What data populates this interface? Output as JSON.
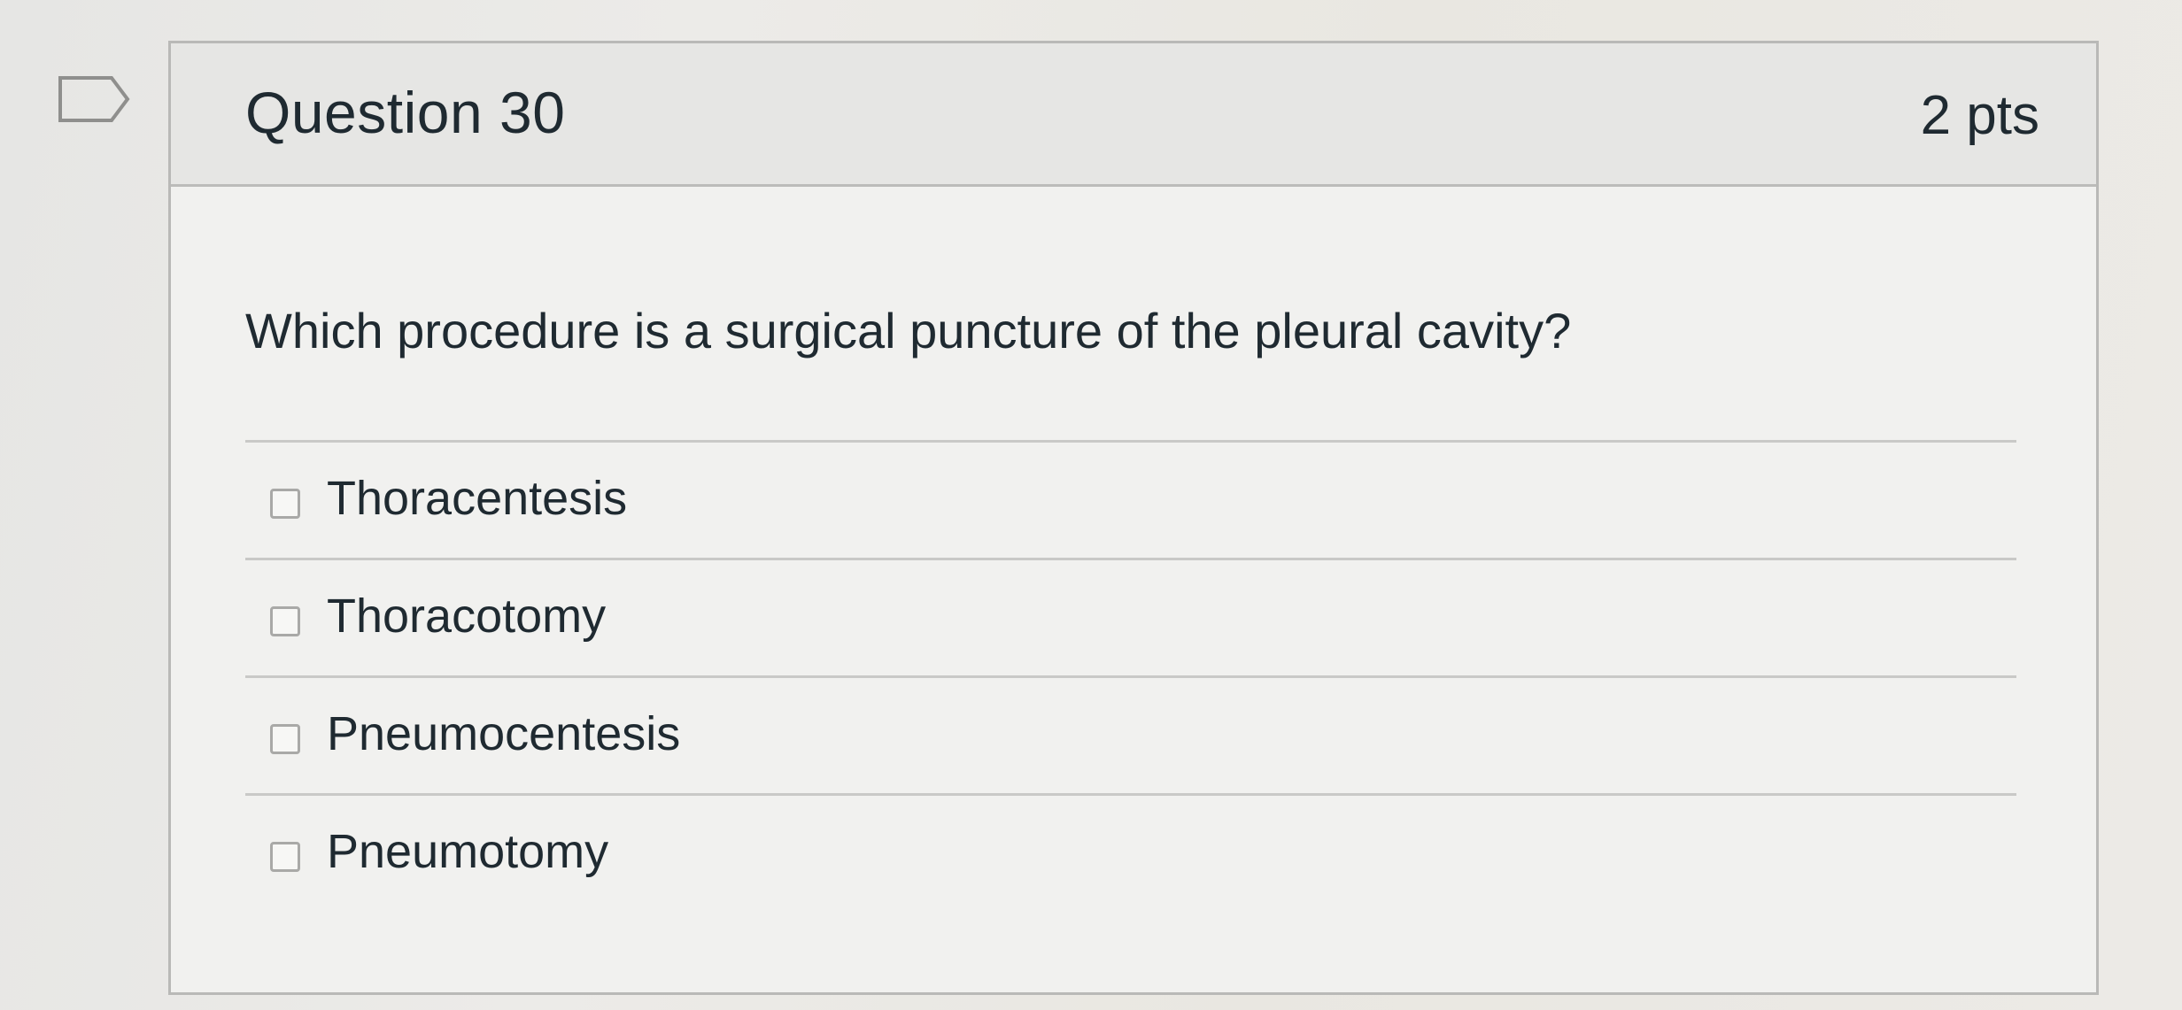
{
  "question": {
    "title": "Question 30",
    "points": "2 pts",
    "text": "Which procedure is a surgical puncture of the pleural cavity?"
  },
  "answers": [
    {
      "label": "Thoracentesis",
      "checked": false
    },
    {
      "label": "Thoracotomy",
      "checked": false
    },
    {
      "label": "Pneumocentesis",
      "checked": false
    },
    {
      "label": "Pneumotomy",
      "checked": false
    }
  ],
  "icons": {
    "flag": "flag-outline-icon",
    "checkbox": "checkbox-unchecked-icon"
  },
  "colors": {
    "header_bg": "#e6e6e4",
    "card_bg": "#f1f1ef",
    "text": "#1f2a31",
    "border": "#b9b9b7"
  }
}
